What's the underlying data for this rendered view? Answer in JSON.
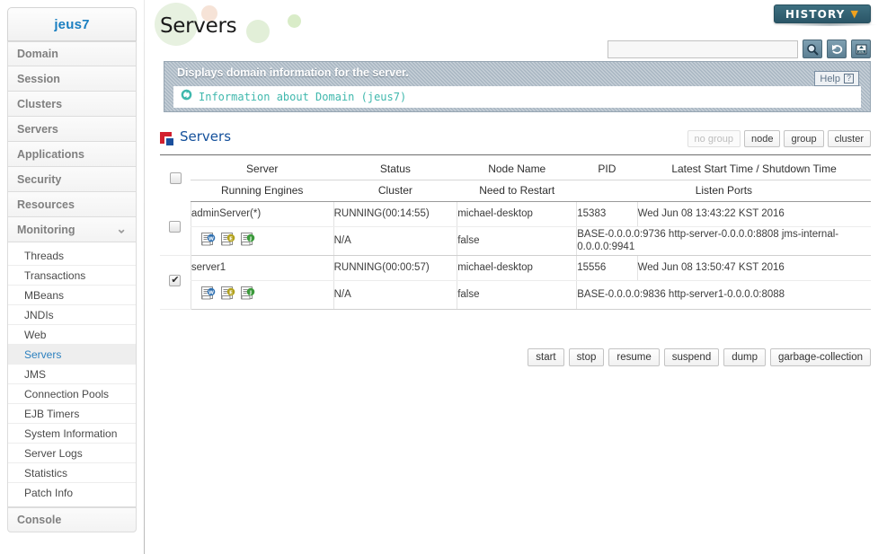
{
  "sidebar": {
    "brand": "jeus7",
    "top_items": [
      {
        "label": "Domain",
        "expandable": false
      },
      {
        "label": "Session",
        "expandable": false
      },
      {
        "label": "Clusters",
        "expandable": false
      },
      {
        "label": "Servers",
        "expandable": false
      },
      {
        "label": "Applications",
        "expandable": false
      },
      {
        "label": "Security",
        "expandable": false
      },
      {
        "label": "Resources",
        "expandable": false
      },
      {
        "label": "Monitoring",
        "expandable": true,
        "chevron": "chevron-down-icon"
      }
    ],
    "submenu": [
      {
        "label": "Threads",
        "active": false
      },
      {
        "label": "Transactions",
        "active": false
      },
      {
        "label": "MBeans",
        "active": false
      },
      {
        "label": "JNDIs",
        "active": false
      },
      {
        "label": "Web",
        "active": false
      },
      {
        "label": "Servers",
        "active": true
      },
      {
        "label": "JMS",
        "active": false
      },
      {
        "label": "Connection Pools",
        "active": false
      },
      {
        "label": "EJB Timers",
        "active": false
      },
      {
        "label": "System Information",
        "active": false
      },
      {
        "label": "Server Logs",
        "active": false
      },
      {
        "label": "Statistics",
        "active": false
      },
      {
        "label": "Patch Info",
        "active": false
      }
    ],
    "bottom_items": [
      {
        "label": "Console"
      }
    ]
  },
  "header": {
    "page_title": "Servers",
    "history_label": "HISTORY",
    "history_caret": "chevron-down-icon",
    "search_value": "",
    "search_placeholder": "",
    "icons": [
      "search-icon",
      "refresh-icon",
      "export-xml-icon"
    ]
  },
  "info": {
    "headline": "Displays domain information for the server.",
    "link_icon": "refresh-circle-icon",
    "link_text": "Information about Domain (jeus7)",
    "help_label": "Help",
    "help_icon": "question-mark-icon"
  },
  "section": {
    "icon": "servers-icon",
    "title": "Servers",
    "group_buttons": [
      {
        "label": "no group",
        "disabled": true
      },
      {
        "label": "node",
        "disabled": false
      },
      {
        "label": "group",
        "disabled": false
      },
      {
        "label": "cluster",
        "disabled": false
      }
    ]
  },
  "table": {
    "headers_row1": [
      "Server",
      "Status",
      "Node Name",
      "PID",
      "Latest Start Time / Shutdown Time"
    ],
    "headers_row2": [
      "Running Engines",
      "Cluster",
      "Need to Restart",
      "Listen Ports"
    ],
    "header_checkbox_checked": false,
    "rows": [
      {
        "checked": false,
        "server": "adminServer(*)",
        "status": "RUNNING(00:14:55)",
        "node_name": "michael-desktop",
        "pid": "15383",
        "latest_time": "Wed Jun 08 13:43:22 KST 2016",
        "engines": [
          "web-engine-icon",
          "ejb-engine-icon",
          "jms-engine-icon"
        ],
        "cluster": "N/A",
        "need_to_restart": "false",
        "listen_ports": "BASE-0.0.0.0:9736 http-server-0.0.0.0:8808 jms-internal-0.0.0.0:9941"
      },
      {
        "checked": true,
        "server": "server1",
        "status": "RUNNING(00:00:57)",
        "node_name": "michael-desktop",
        "pid": "15556",
        "latest_time": "Wed Jun 08 13:50:47 KST 2016",
        "engines": [
          "web-engine-icon",
          "ejb-engine-icon",
          "jms-engine-icon"
        ],
        "cluster": "N/A",
        "need_to_restart": "false",
        "listen_ports": "BASE-0.0.0.0:9836 http-server1-0.0.0.0:8088"
      }
    ]
  },
  "actions": [
    {
      "label": "start"
    },
    {
      "label": "stop"
    },
    {
      "label": "resume"
    },
    {
      "label": "suspend"
    },
    {
      "label": "dump"
    },
    {
      "label": "garbage-collection"
    }
  ],
  "colors": {
    "brand_blue": "#1a7fc1",
    "section_title": "#14509b",
    "accent_red": "#d2202f",
    "history_bg": "#2b5667",
    "history_caret": "#f0a21e",
    "info_link": "#3fb8ad",
    "info_panel": "#a8b6c2"
  }
}
